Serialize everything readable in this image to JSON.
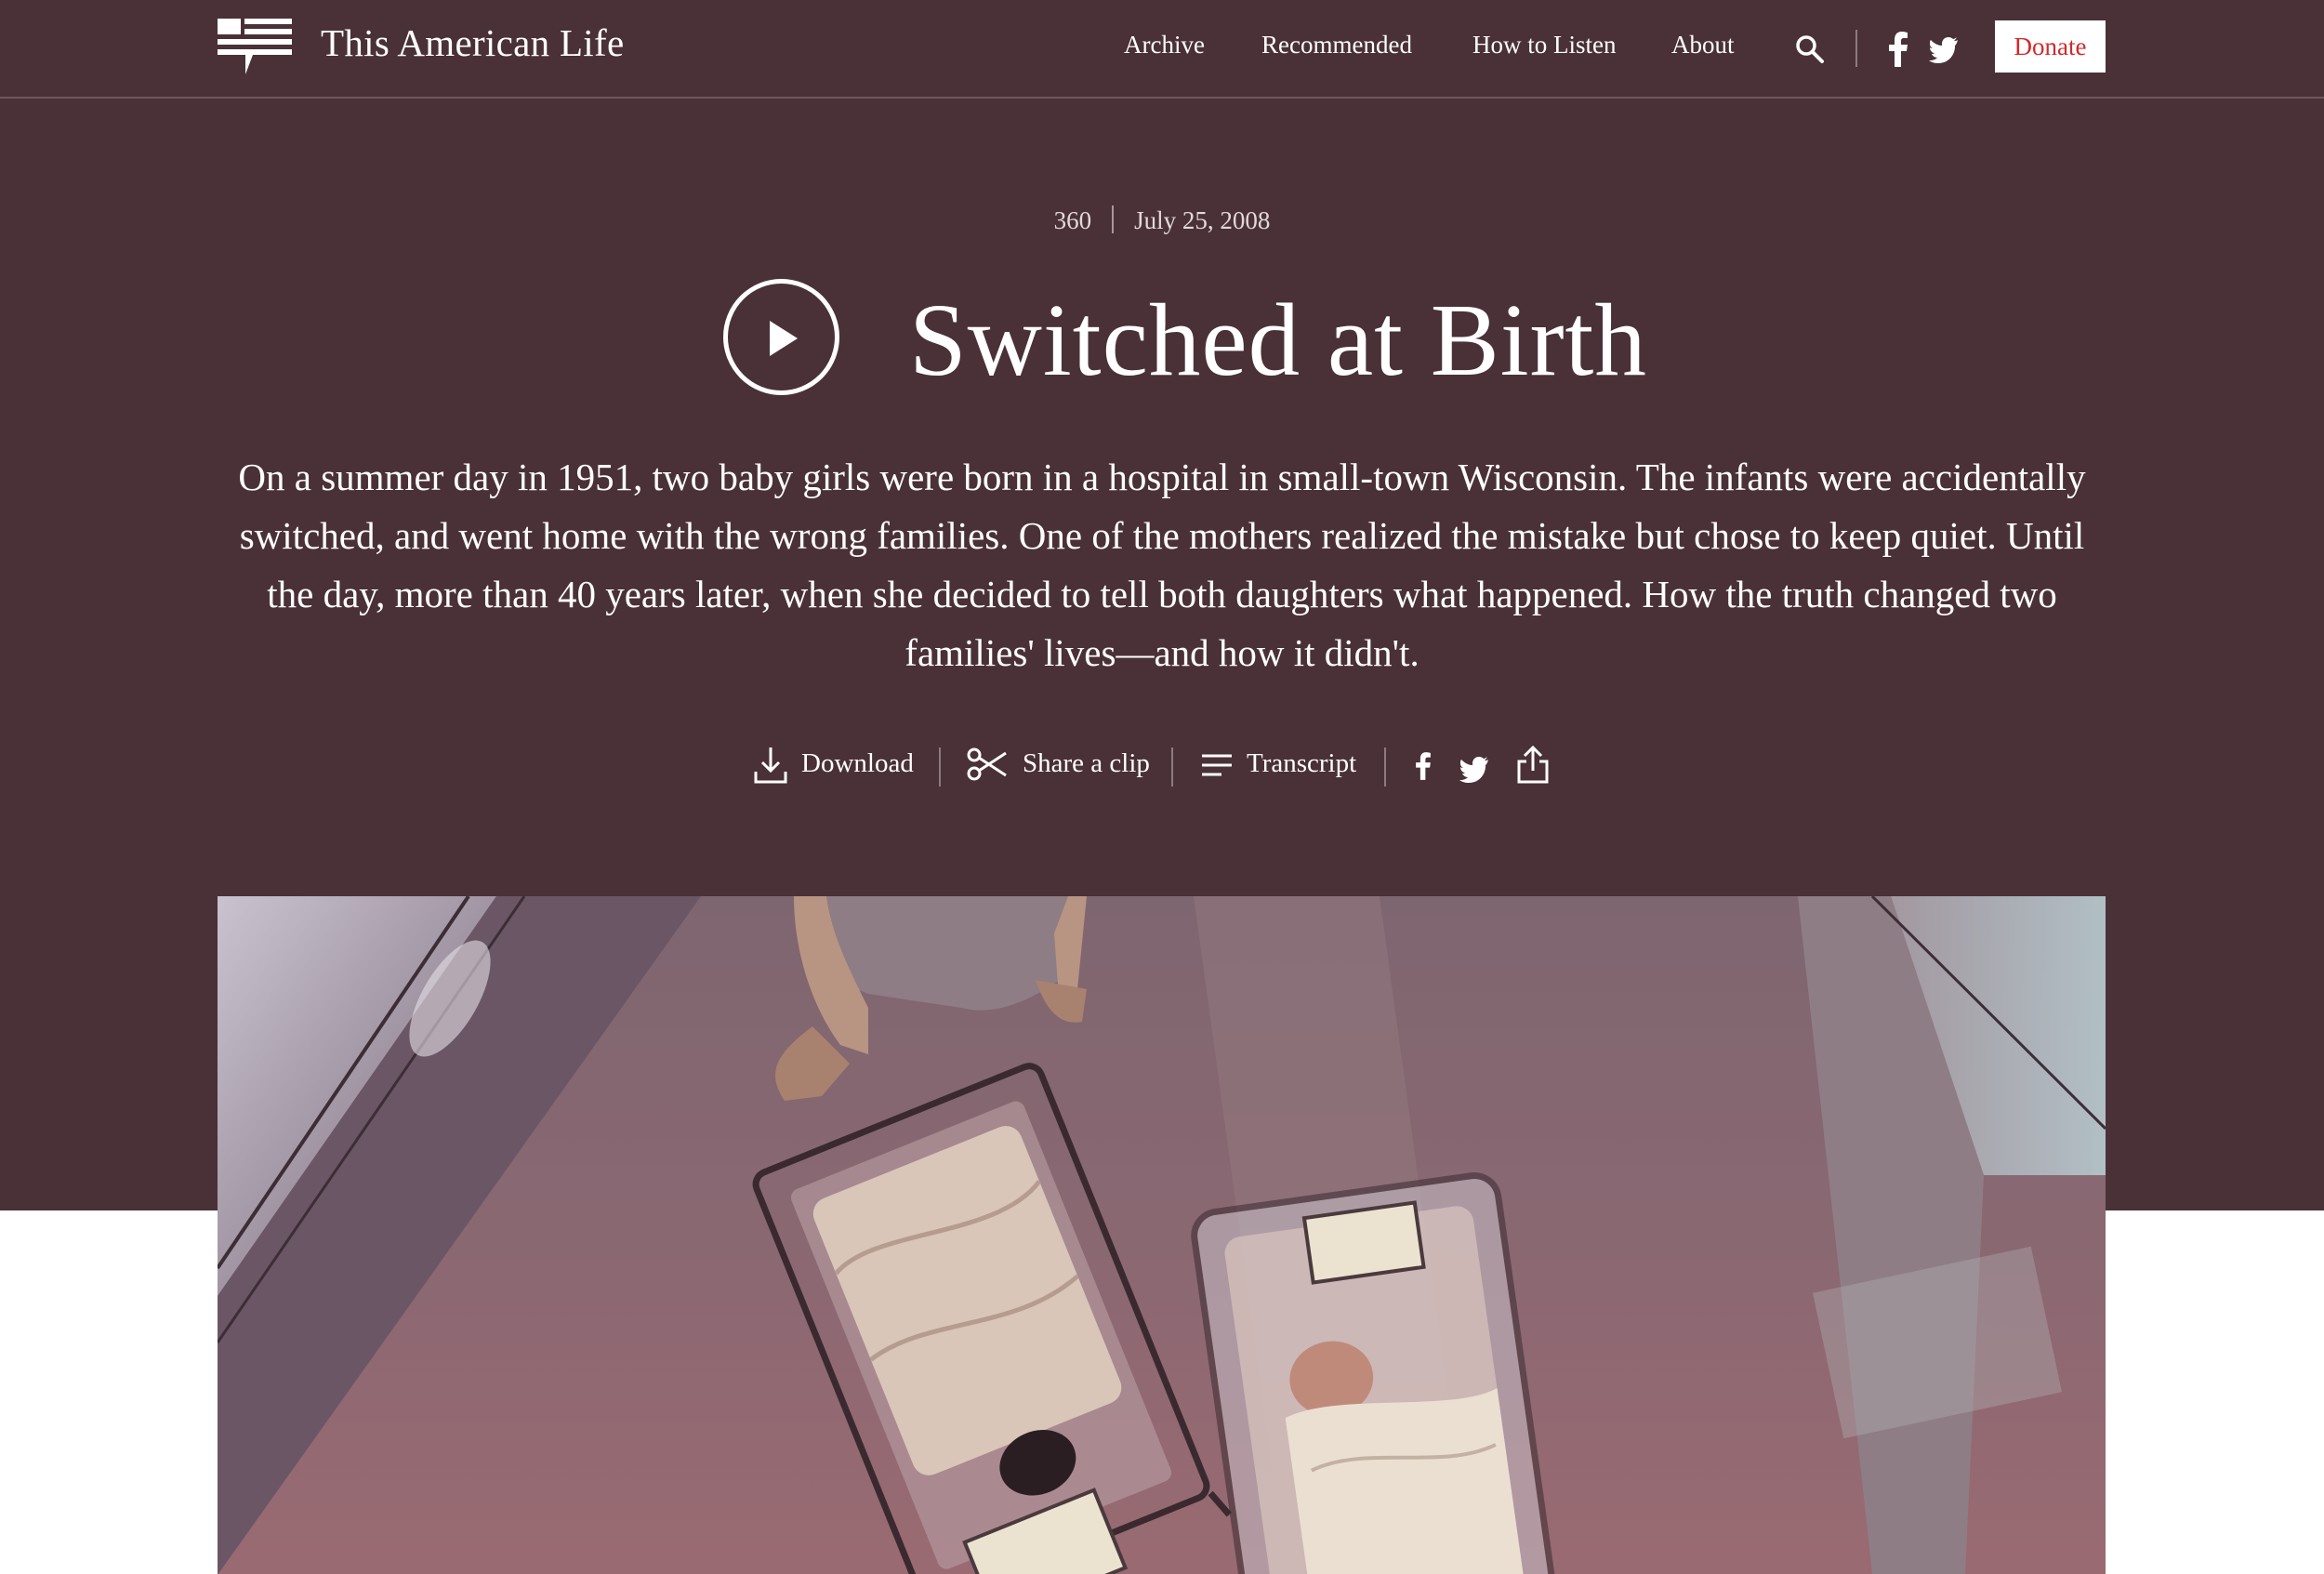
{
  "header": {
    "logo_text": "This American Life",
    "nav": [
      "Archive",
      "Recommended",
      "How to Listen",
      "About"
    ],
    "donate_label": "Donate"
  },
  "episode": {
    "number": "360",
    "date": "July 25, 2008",
    "title": "Switched at Birth",
    "description": "On a summer day in 1951, two baby girls were born in a hospital in small-town Wisconsin. The infants were accidentally switched, and went home with the wrong families. One of the mothers realized the mistake but chose to keep quiet. Until the day, more than 40 years later, when she decided to tell both daughters what happened. How the truth changed two families' lives—and how it didn't."
  },
  "actions": {
    "download_label": "Download",
    "share_clip_label": "Share a clip",
    "transcript_label": "Transcript"
  },
  "colors": {
    "hero_background": "#4a3137",
    "donate_text": "#d12a2a"
  }
}
